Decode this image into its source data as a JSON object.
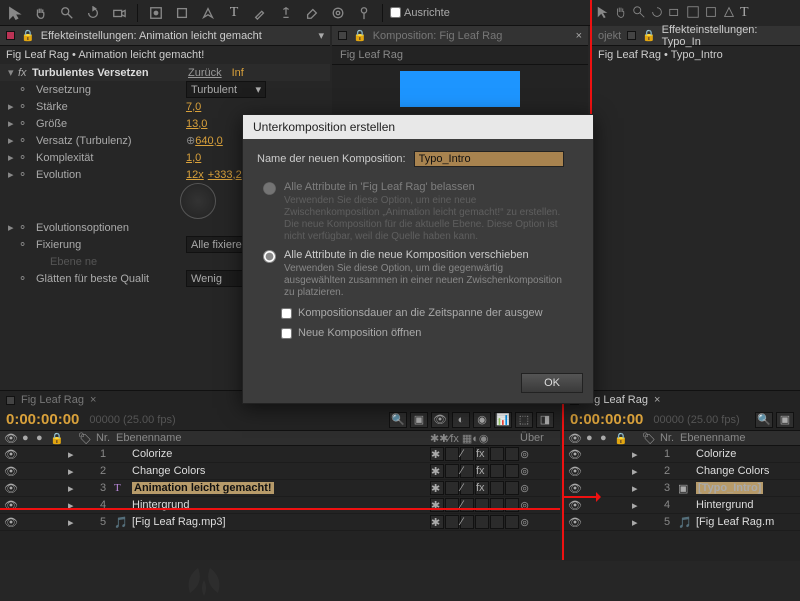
{
  "toolbar": {
    "ausrichten": "Ausrichte"
  },
  "left_panel": {
    "tab": "Effekteinstellungen: Animation leicht gemacht",
    "crumb": "Fig Leaf Rag • Animation leicht gemacht!",
    "effect": "Turbulentes Versetzen",
    "reset": "Zurück",
    "info": "Inf",
    "props": [
      {
        "name": "Versetzung",
        "value": "Turbulent",
        "type": "select"
      },
      {
        "name": "Stärke",
        "value": "7,0"
      },
      {
        "name": "Größe",
        "value": "13,0"
      },
      {
        "name": "Versatz (Turbulenz)",
        "value": "640,0",
        "anchor": true
      },
      {
        "name": "Komplexität",
        "value": "1,0"
      },
      {
        "name": "Evolution",
        "value": "12x",
        "value2": "+333,2"
      },
      {
        "name": "Evolutionsoptionen"
      },
      {
        "name": "Fixierung",
        "value": "Alle fixiere",
        "type": "select"
      },
      {
        "name_dim": "Ebene ne"
      },
      {
        "name": "Glätten für beste Qualit",
        "value": "Wenig",
        "type": "select"
      }
    ]
  },
  "comp_panel": {
    "tab": "Komposition: Fig Leaf Rag",
    "bread": "Fig Leaf Rag"
  },
  "right_panel": {
    "tab_projekt": "ojekt",
    "tab_efx": "Effekteinstellungen: Typo_In",
    "crumb": "Fig Leaf Rag • Typo_Intro"
  },
  "dialog": {
    "title": "Unterkomposition erstellen",
    "name_label": "Name der neuen Komposition:",
    "name_value": "Typo_Intro",
    "opt1": "Alle Attribute in 'Fig Leaf Rag' belassen",
    "opt1_hint": "Verwenden Sie diese Option, um eine neue Zwischenkomposition „Animation leicht gemacht!“ zu erstellen. Die neue Komposition für die aktuelle Ebene. Diese Option ist nicht verfügbar, weil die Quelle haben kann.",
    "opt2": "Alle Attribute in die neue Komposition verschieben",
    "opt2_hint": "Verwenden Sie diese Option, um die gegenwärtig ausgewählten zusammen in einer neuen Zwischenkomposition zu platzieren.",
    "chk1": "Kompositionsdauer an die Zeitspanne der ausgew",
    "chk2": "Neue Komposition öffnen",
    "ok": "OK"
  },
  "timeline_left": {
    "tab": "Fig Leaf Rag",
    "time": "0:00:00:00",
    "fps": "00000 (25.00 fps)",
    "col_nr": "Nr.",
    "col_name": "Ebenenname",
    "col_uber": "Über",
    "layers": [
      {
        "nr": "1",
        "name": "Colorize",
        "color": "#c8c395"
      },
      {
        "nr": "2",
        "name": "Change Colors",
        "color": "#c8c395"
      },
      {
        "nr": "3",
        "name": "Animation leicht gemacht!",
        "color": "#d33",
        "sel": true,
        "type": "T"
      },
      {
        "nr": "4",
        "name": "Hintergrund",
        "color": "#d33"
      },
      {
        "nr": "5",
        "name": "[Fig Leaf Rag.mp3]",
        "color": "#888",
        "type": "audio"
      }
    ]
  },
  "timeline_right": {
    "tab": "Fig Leaf Rag",
    "time": "0:00:00:00",
    "fps": "00000 (25.00 fps)",
    "col_nr": "Nr.",
    "col_name": "Ebenenname",
    "layers": [
      {
        "nr": "1",
        "name": "Colorize",
        "color": "#c8c395"
      },
      {
        "nr": "2",
        "name": "Change Colors",
        "color": "#c8c395"
      },
      {
        "nr": "3",
        "name": "[Typo_Intro]",
        "color": "#c8c395",
        "sel": true,
        "type": "comp"
      },
      {
        "nr": "4",
        "name": "Hintergrund",
        "color": "#d33"
      },
      {
        "nr": "5",
        "name": "[Fig Leaf Rag.m",
        "color": "#888",
        "type": "audio"
      }
    ]
  }
}
